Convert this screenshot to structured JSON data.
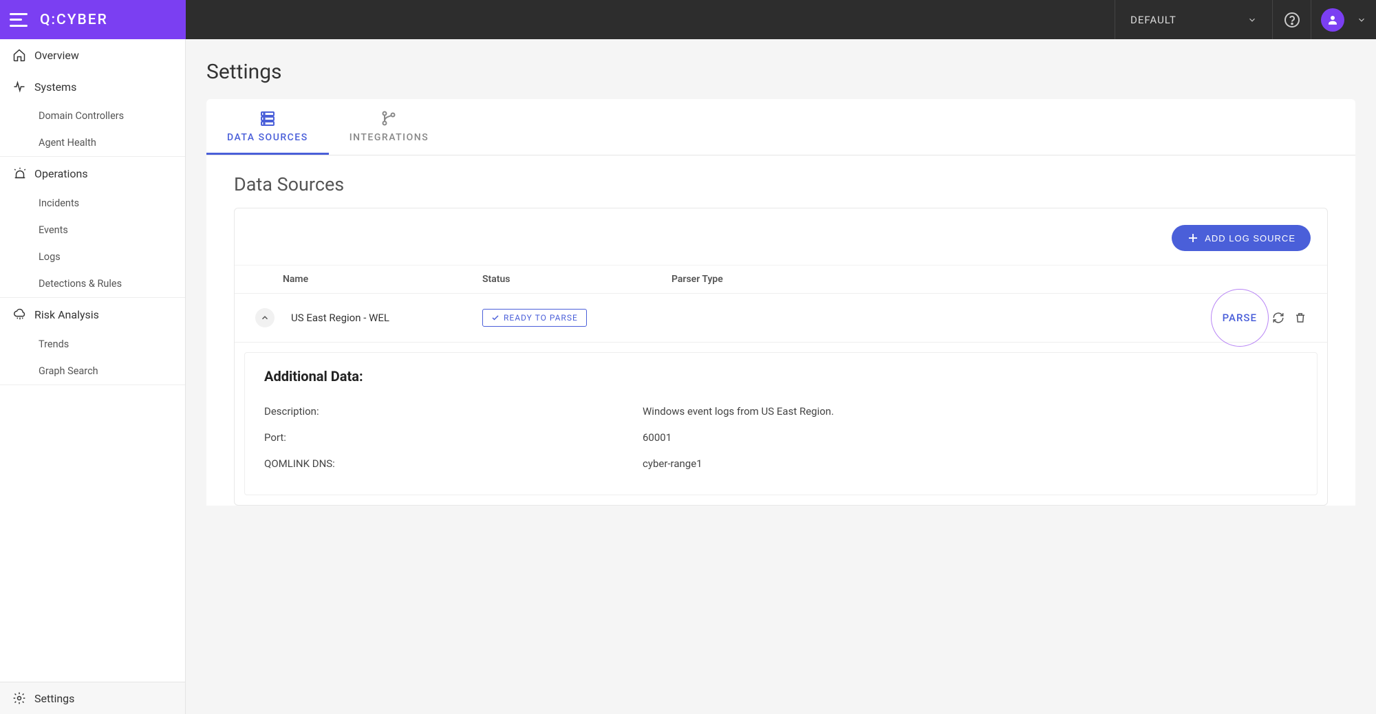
{
  "logo": "Q:CYBER",
  "env": "DEFAULT",
  "sidebar": {
    "items": [
      {
        "label": "Overview"
      },
      {
        "label": "Systems"
      },
      {
        "label": "Operations"
      },
      {
        "label": "Risk Analysis"
      }
    ],
    "systems_subs": [
      {
        "label": "Domain Controllers"
      },
      {
        "label": "Agent Health"
      }
    ],
    "operations_subs": [
      {
        "label": "Incidents"
      },
      {
        "label": "Events"
      },
      {
        "label": "Logs"
      },
      {
        "label": "Detections & Rules"
      }
    ],
    "risk_subs": [
      {
        "label": "Trends"
      },
      {
        "label": "Graph Search"
      }
    ],
    "settings_label": "Settings"
  },
  "page": {
    "title": "Settings",
    "tabs": [
      {
        "label": "DATA SOURCES"
      },
      {
        "label": "INTEGRATIONS"
      }
    ],
    "section_title": "Data Sources",
    "add_button": "ADD LOG SOURCE",
    "columns": {
      "name": "Name",
      "status": "Status",
      "parser": "Parser Type"
    },
    "row": {
      "name": "US East Region - WEL",
      "status": "READY TO PARSE",
      "parse_btn": "PARSE"
    },
    "details": {
      "title": "Additional Data:",
      "rows": [
        {
          "label": "Description:",
          "value": "Windows event logs from US East Region."
        },
        {
          "label": "Port:",
          "value": "60001"
        },
        {
          "label": "QOMLINK DNS:",
          "value": "cyber-range1"
        }
      ]
    }
  }
}
